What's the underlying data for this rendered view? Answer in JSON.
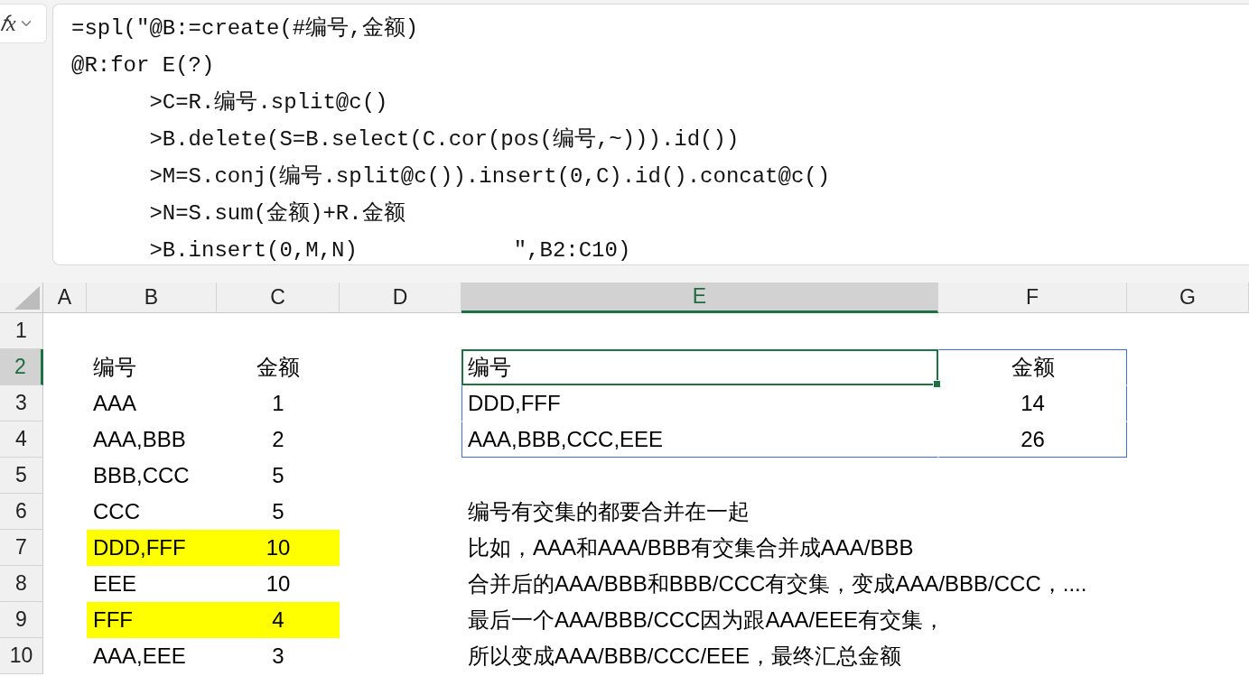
{
  "formula_bar": {
    "function_button": "𝑓x",
    "formula_lines": [
      "=spl(\"@B:=create(#编号,金额)",
      "@R:for E(?)",
      "      >C=R.编号.split@c()",
      "      >B.delete(S=B.select(C.cor(pos(编号,~))).id())",
      "      >M=S.conj(编号.split@c()).insert(0,C).id().concat@c()",
      "      >N=S.sum(金额)+R.金额",
      "      >B.insert(0,M,N)            \",B2:C10)"
    ]
  },
  "columns": [
    {
      "label": "A",
      "selected": false
    },
    {
      "label": "B",
      "selected": false
    },
    {
      "label": "C",
      "selected": false
    },
    {
      "label": "D",
      "selected": false
    },
    {
      "label": "E",
      "selected": true
    },
    {
      "label": "F",
      "selected": false
    },
    {
      "label": "G",
      "selected": false
    }
  ],
  "rows": [
    {
      "label": "1",
      "selected": false
    },
    {
      "label": "2",
      "selected": true
    },
    {
      "label": "3",
      "selected": false
    },
    {
      "label": "4",
      "selected": false
    },
    {
      "label": "5",
      "selected": false
    },
    {
      "label": "6",
      "selected": false
    },
    {
      "label": "7",
      "selected": false
    },
    {
      "label": "8",
      "selected": false
    },
    {
      "label": "9",
      "selected": false
    },
    {
      "label": "10",
      "selected": false
    }
  ],
  "source_table": {
    "header": [
      "编号",
      "金额"
    ],
    "rows": [
      {
        "id": "AAA",
        "amount": "1",
        "highlighted": false
      },
      {
        "id": "AAA,BBB",
        "amount": "2",
        "highlighted": false
      },
      {
        "id": "BBB,CCC",
        "amount": "5",
        "highlighted": false
      },
      {
        "id": "CCC",
        "amount": "5",
        "highlighted": false
      },
      {
        "id": "DDD,FFF",
        "amount": "10",
        "highlighted": true
      },
      {
        "id": "EEE",
        "amount": "10",
        "highlighted": false
      },
      {
        "id": "FFF",
        "amount": "4",
        "highlighted": true
      },
      {
        "id": "AAA,EEE",
        "amount": "3",
        "highlighted": false
      }
    ]
  },
  "result_table": {
    "header": [
      {
        "text": "编号",
        "selected": true
      },
      {
        "text": "金额",
        "selected": false
      }
    ],
    "rows": [
      {
        "id": "DDD,FFF",
        "amount": "14"
      },
      {
        "id": "AAA,BBB,CCC,EEE",
        "amount": "26"
      }
    ]
  },
  "notes": [
    "编号有交集的都要合并在一起",
    "比如，AAA和AAA/BBB有交集合并成AAA/BBB",
    "合并后的AAA/BBB和BBB/CCC有交集，变成AAA/BBB/CCC，....",
    "最后一个AAA/BBB/CCC因为跟AAA/EEE有交集，",
    "所以变成AAA/BBB/CCC/EEE，最终汇总金额"
  ]
}
